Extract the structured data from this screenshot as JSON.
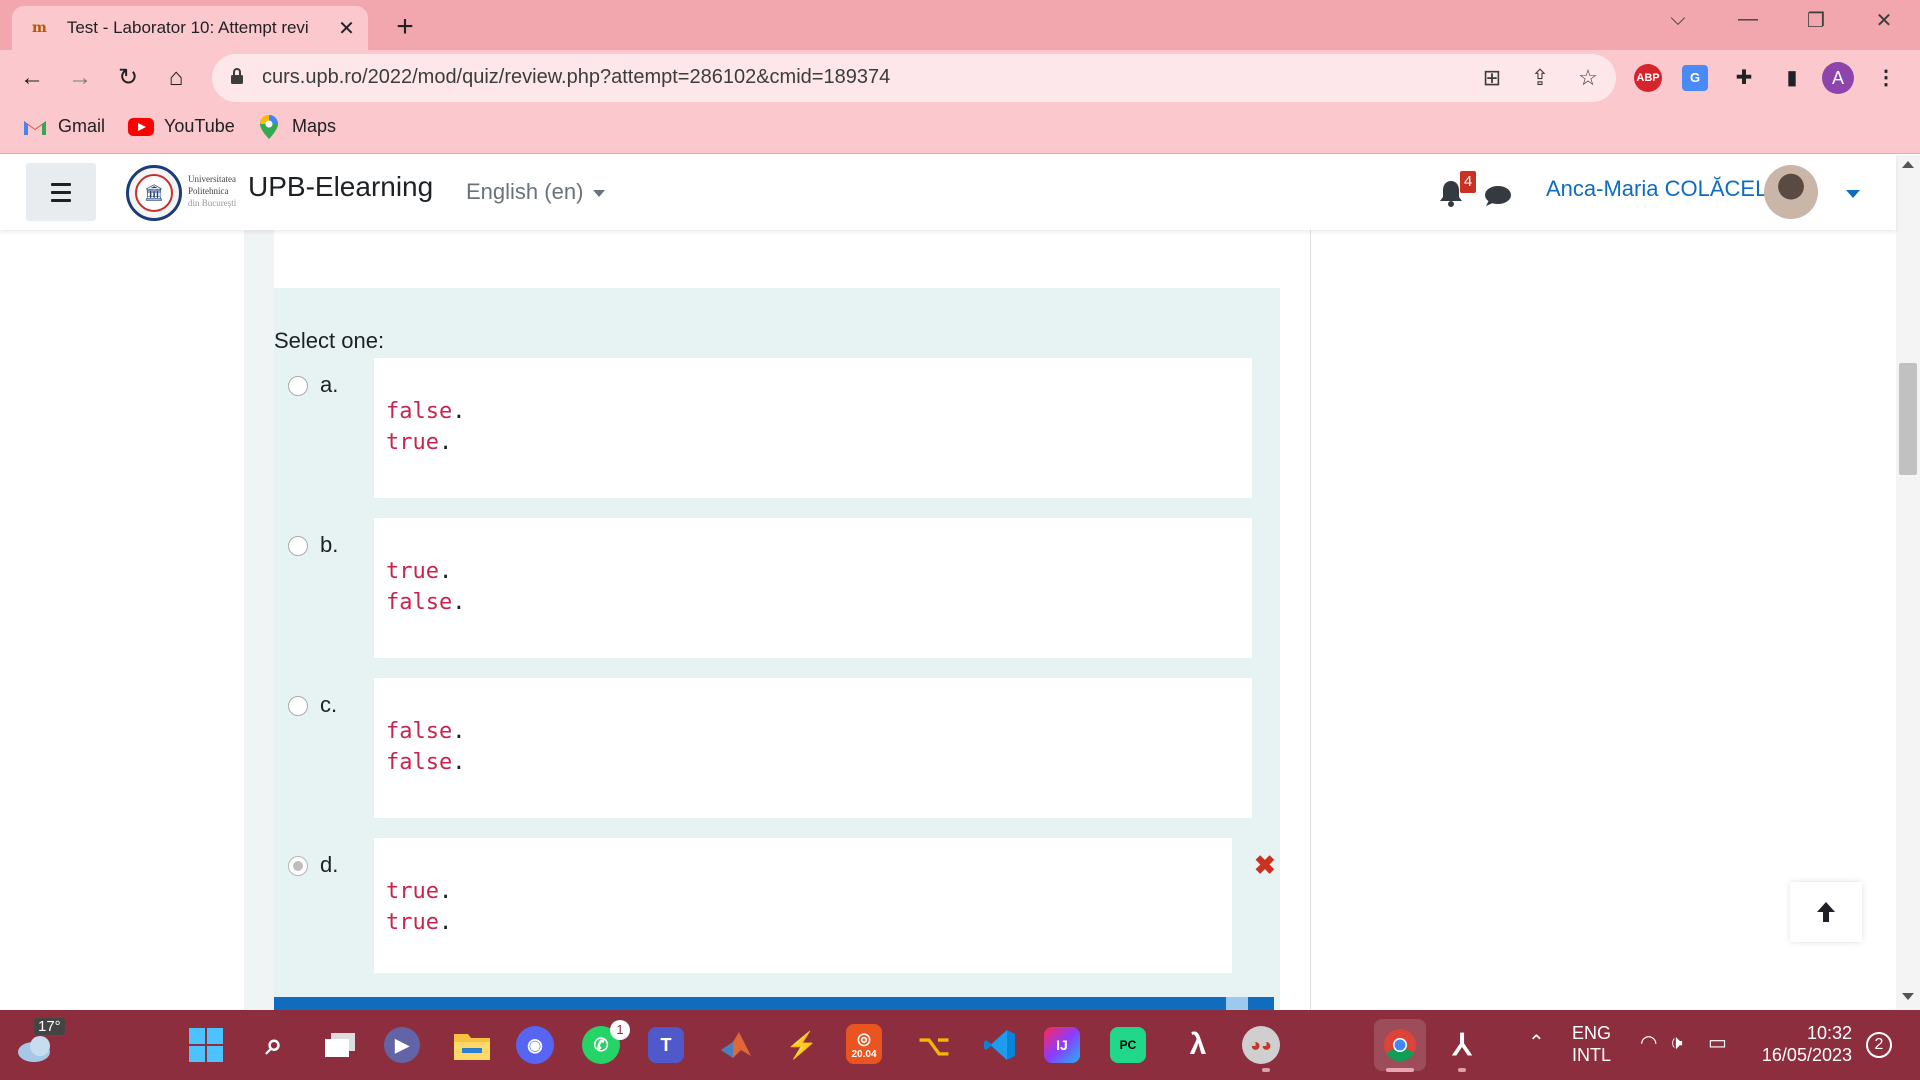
{
  "browser": {
    "tab_title": "Test - Laborator 10: Attempt revi",
    "new_tab": "+",
    "url": "curs.upb.ro/2022/mod/quiz/review.php?attempt=286102&cmid=189374",
    "profile_letter": "A",
    "abp_label": "ABP",
    "bookmarks": [
      {
        "label": "Gmail"
      },
      {
        "label": "YouTube"
      },
      {
        "label": "Maps"
      }
    ]
  },
  "moodle": {
    "logo_text": [
      "Universitatea",
      "Politehnica",
      "din București"
    ],
    "site_name": "UPB-Elearning",
    "language": "English (en)",
    "notification_count": "4",
    "user_name": "Anca-Maria COLĂCEL"
  },
  "question": {
    "prompt": "Select one:",
    "options": [
      {
        "letter": "a.",
        "line1": "false",
        "line2": "true",
        "selected": false,
        "wrong": false
      },
      {
        "letter": "b.",
        "line1": "true",
        "line2": "false",
        "selected": false,
        "wrong": false
      },
      {
        "letter": "c.",
        "line1": "false",
        "line2": "false",
        "selected": false,
        "wrong": false
      },
      {
        "letter": "d.",
        "line1": "true",
        "line2": "true",
        "selected": true,
        "wrong": true
      }
    ],
    "punct": "."
  },
  "taskbar": {
    "temperature": "17°",
    "whatsapp_badge": "1",
    "ubuntu_label": "20.04",
    "lang_line1": "ENG",
    "lang_line2": "INTL",
    "time": "10:32",
    "date": "16/05/2023",
    "notification_count": "2"
  },
  "colors": {
    "chrome_frame": "#f2a6ae",
    "chrome_toolbar": "#fbc8cd",
    "moodle_link": "#0f6cbf",
    "code_keyword": "#c7254e",
    "incorrect": "#ca3120",
    "taskbar": "#8c2e3e"
  }
}
